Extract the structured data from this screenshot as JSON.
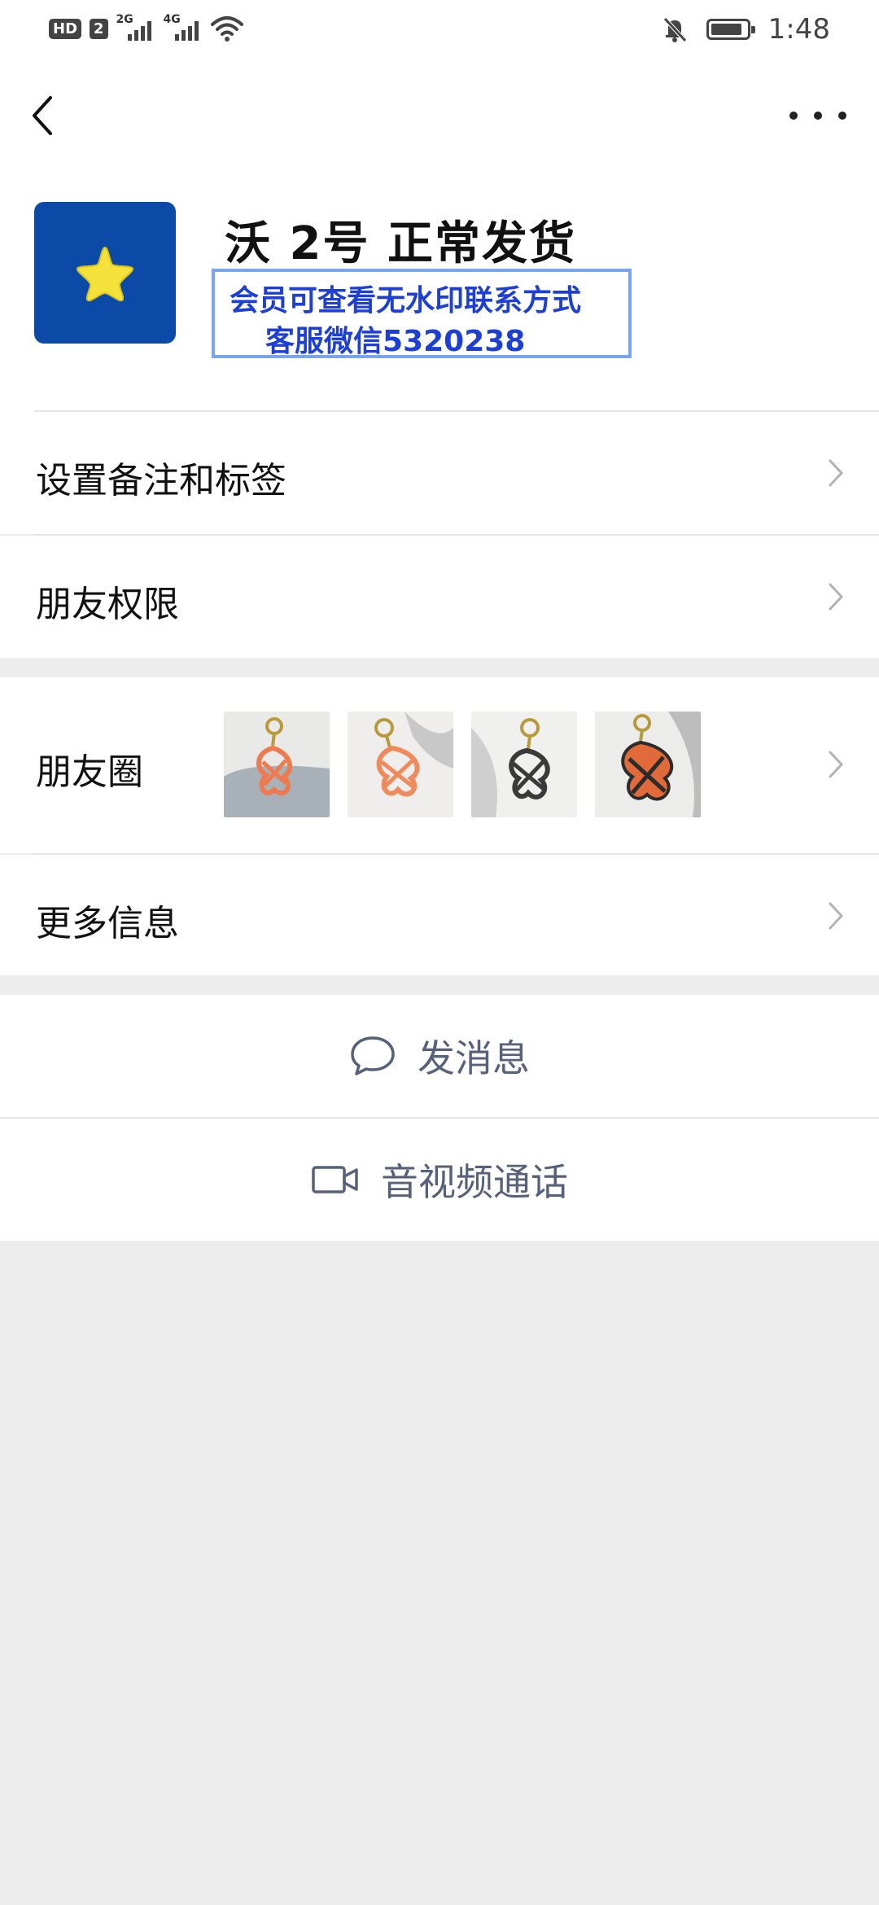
{
  "status_bar": {
    "hd_label": "HD",
    "sim_label": "2",
    "net1": "2G",
    "net2": "4G",
    "time": "1:48",
    "icons": [
      "signal-icon",
      "wifi-icon",
      "mute-bell-icon",
      "battery-icon"
    ],
    "battery_level": 0.9
  },
  "nav": {
    "back_icon": "chevron-left-icon",
    "more_icon": "more-dots-icon"
  },
  "profile": {
    "nickname": "沃 2号 正常发货",
    "watermark_line1": "会员可查看无水印联系方式",
    "watermark_line2": "客服微信5320238",
    "avatar_icon": "star-icon",
    "avatar_color": "#0b4aa6"
  },
  "rows": {
    "remark": "设置备注和标签",
    "permissions": "朋友权限",
    "moments": "朋友圈",
    "more_info": "更多信息"
  },
  "moments_thumbs": [
    "orange-keychain",
    "orange-keychain",
    "black-keychain",
    "orange-black-keychain"
  ],
  "actions": {
    "message": "发消息",
    "video_call": "音视频通话"
  },
  "colors": {
    "action_text": "#57617a",
    "watermark_text": "#1d3fd6",
    "page_bg": "#ededed"
  }
}
